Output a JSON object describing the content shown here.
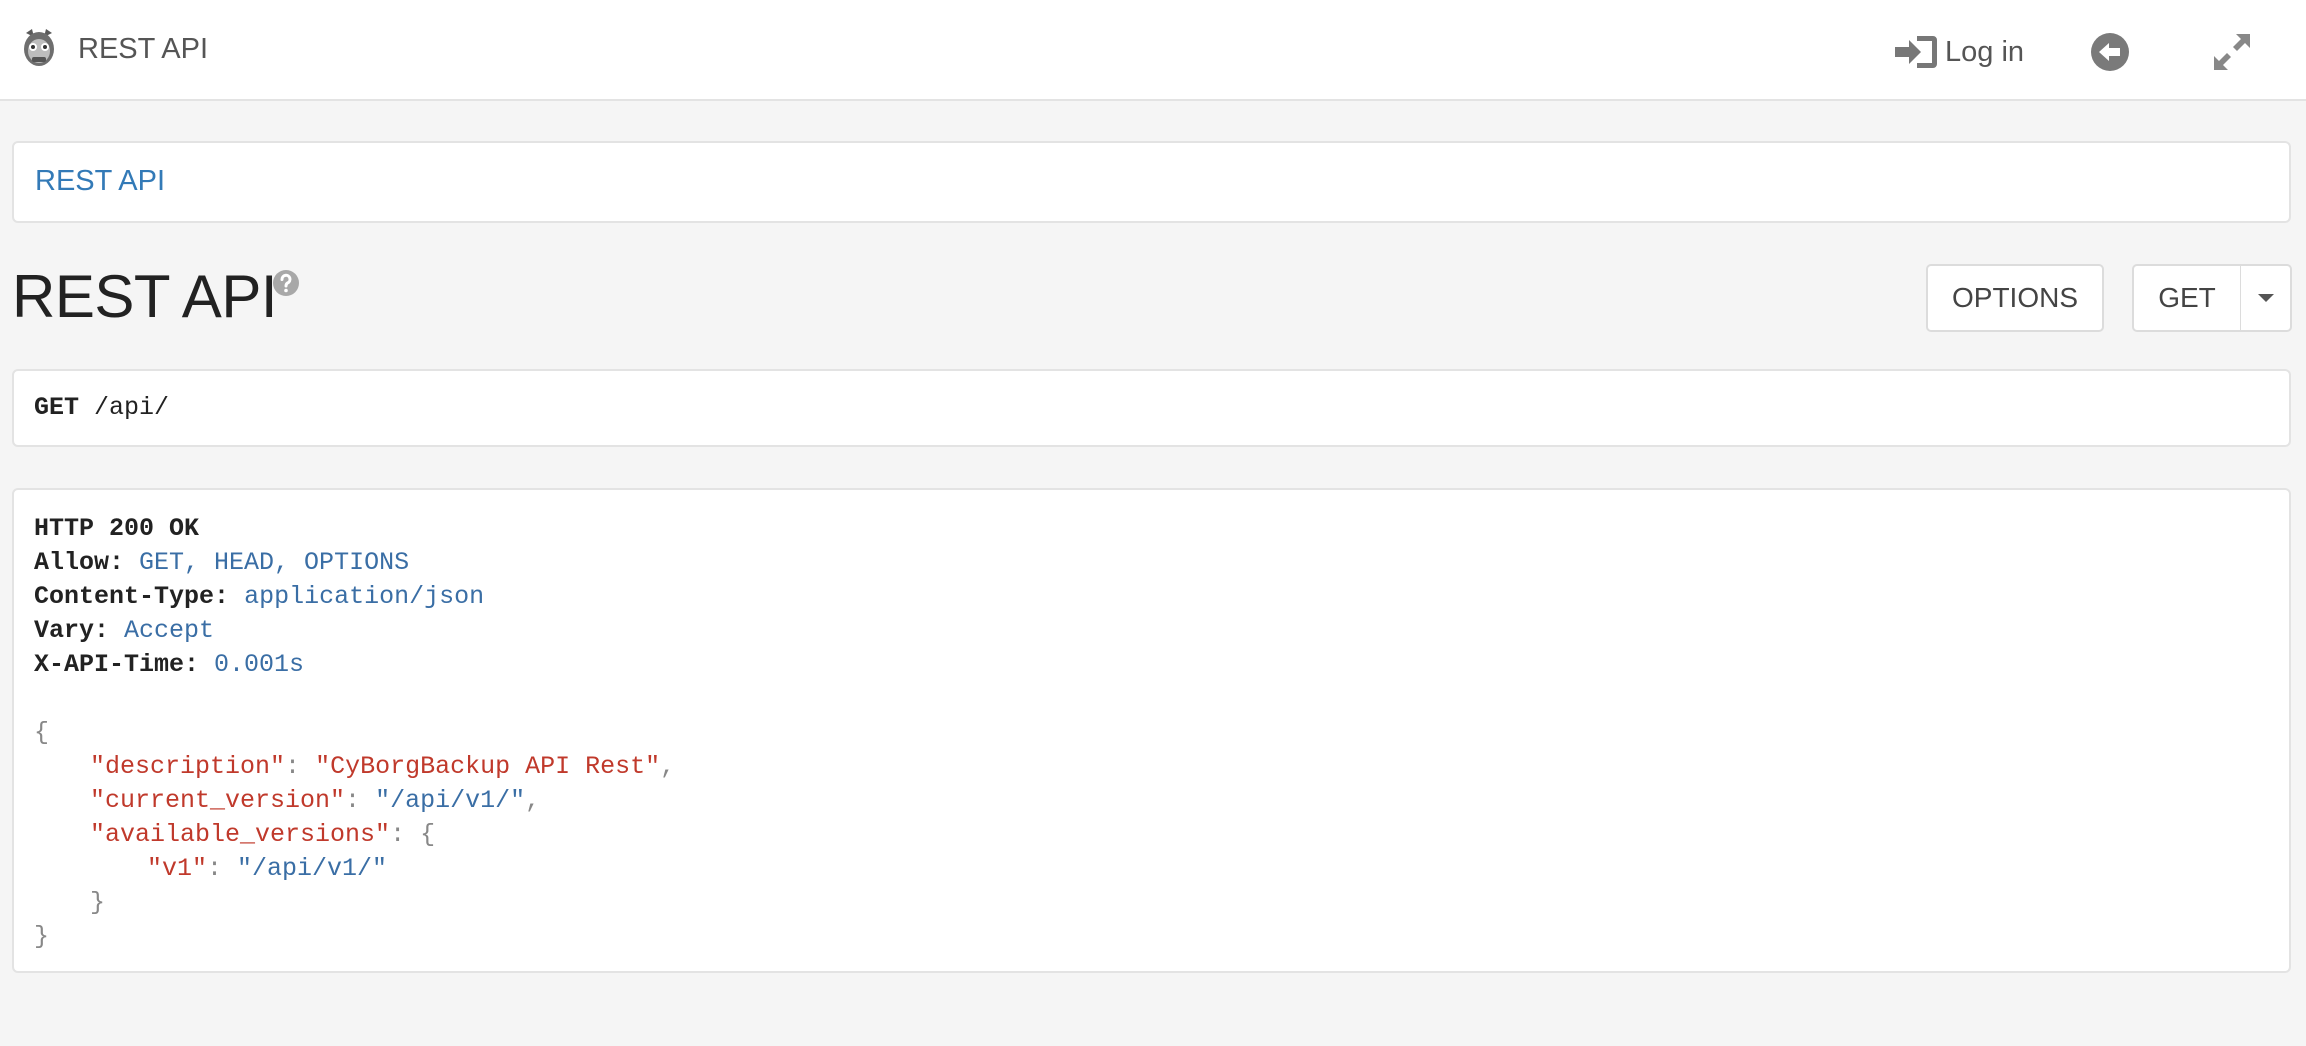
{
  "navbar": {
    "brand": "REST API",
    "login": "Log in"
  },
  "breadcrumb": {
    "item": "REST API"
  },
  "page": {
    "title": "REST API",
    "options_button": "OPTIONS",
    "get_button": "GET"
  },
  "request": {
    "method": "GET",
    "path": "/api/"
  },
  "response": {
    "status": "HTTP 200 OK",
    "headers": [
      {
        "key": "Allow:",
        "value": "GET, HEAD, OPTIONS"
      },
      {
        "key": "Content-Type:",
        "value": "application/json"
      },
      {
        "key": "Vary:",
        "value": "Accept"
      },
      {
        "key": "X-API-Time:",
        "value": "0.001s"
      }
    ],
    "body": {
      "open": "{",
      "close": "}",
      "description_key": "\"description\"",
      "description_value": "\"CyBorgBackup API Rest\"",
      "current_version_key": "\"current_version\"",
      "current_version_value": "\"/api/v1/\"",
      "available_versions_key": "\"available_versions\"",
      "v1_key": "\"v1\"",
      "v1_value": "\"/api/v1/\""
    }
  },
  "colors": {
    "link": "#337ab7",
    "json_key": "#c0392b",
    "json_link": "#3a6ea5",
    "background": "#f5f5f5"
  },
  "icons": {
    "brand": "cyborg-logo-icon",
    "login": "sign-in-icon",
    "back": "arrow-circle-left-icon",
    "expand": "expand-arrows-icon",
    "help": "question-circle-icon",
    "caret": "caret-down-icon"
  }
}
